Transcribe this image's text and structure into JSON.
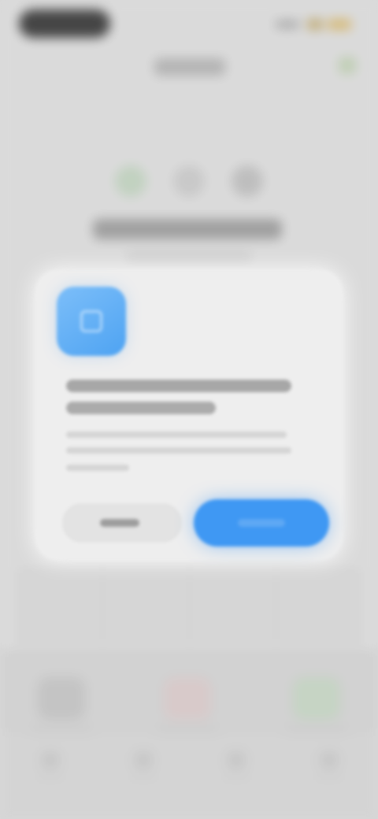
{
  "status_bar": {
    "time": "",
    "colors": {
      "pill": "#1e1e1e",
      "wifi": "#b9a060",
      "battery": "#d2b060"
    }
  },
  "nav": {
    "title": "",
    "action_icon": "check-icon"
  },
  "steps": {
    "count": 3,
    "active_index": 0,
    "colors": [
      "#b9cdb7",
      "#c2c2c2",
      "#b5b5b5"
    ]
  },
  "content": {
    "headline": "",
    "subline": ""
  },
  "dialog": {
    "icon": "app-icon",
    "icon_color": "#4ea3f2",
    "title": "",
    "body": "",
    "secondary_button": "",
    "primary_button": "",
    "primary_color": "#3f98f3"
  },
  "quick_actions": [
    {
      "icon": "user-icon",
      "label": ""
    },
    {
      "icon": "heart-icon",
      "label": ""
    },
    {
      "icon": "leaf-icon",
      "label": ""
    }
  ],
  "tab_bar": [
    {
      "icon": "home-icon",
      "label": ""
    },
    {
      "icon": "search-icon",
      "label": ""
    },
    {
      "icon": "calendar-icon",
      "label": ""
    },
    {
      "icon": "profile-icon",
      "label": ""
    }
  ]
}
